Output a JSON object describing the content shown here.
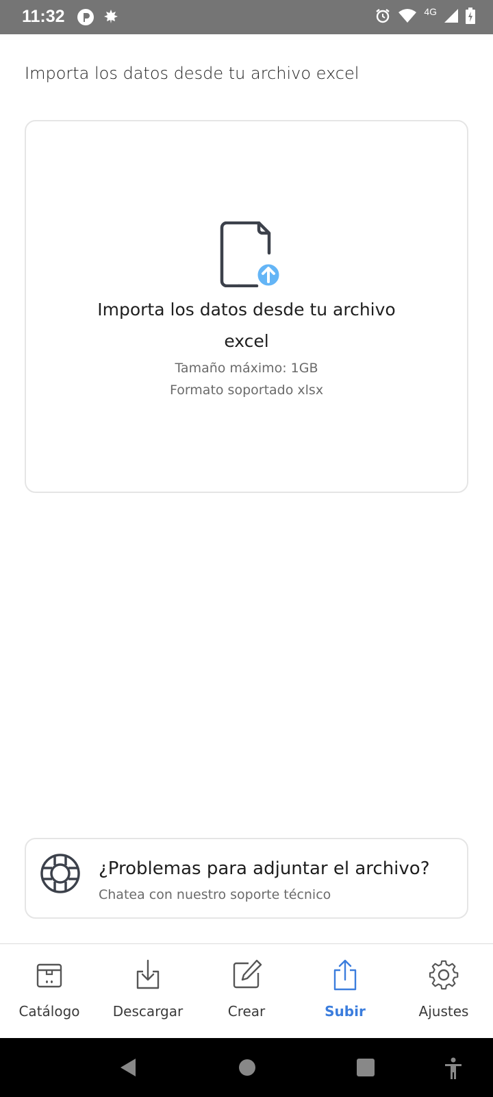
{
  "status_bar": {
    "time": "11:32",
    "network": "4G",
    "icons_left": [
      "p-app-icon",
      "leaf-icon"
    ],
    "icons_right": [
      "alarm-icon",
      "wifi-icon",
      "signal-icon",
      "battery-charging-icon"
    ]
  },
  "page": {
    "subtitle": "Importa los datos desde tu archivo excel"
  },
  "upload": {
    "title": "Importa los datos desde tu archivo excel",
    "max_size": "Tamaño máximo: 1GB",
    "format": "Formato soportado xlsx",
    "icon": "file-upload-icon",
    "accent": "#64b5f6"
  },
  "help": {
    "title": "¿Problemas para adjuntar el archivo?",
    "subtitle": "Chatea con nuestro soporte técnico",
    "icon": "lifebuoy-icon"
  },
  "bottom_nav": {
    "items": [
      {
        "label": "Catálogo",
        "icon": "catalog-box-icon",
        "active": false
      },
      {
        "label": "Descargar",
        "icon": "download-icon",
        "active": false
      },
      {
        "label": "Crear",
        "icon": "edit-icon",
        "active": false
      },
      {
        "label": "Subir",
        "icon": "upload-share-icon",
        "active": true
      },
      {
        "label": "Ajustes",
        "icon": "gear-icon",
        "active": false
      }
    ],
    "active_color": "#3b7ddd"
  },
  "system_nav": {
    "buttons": [
      "back-icon",
      "home-icon",
      "recents-icon",
      "accessibility-icon"
    ]
  }
}
